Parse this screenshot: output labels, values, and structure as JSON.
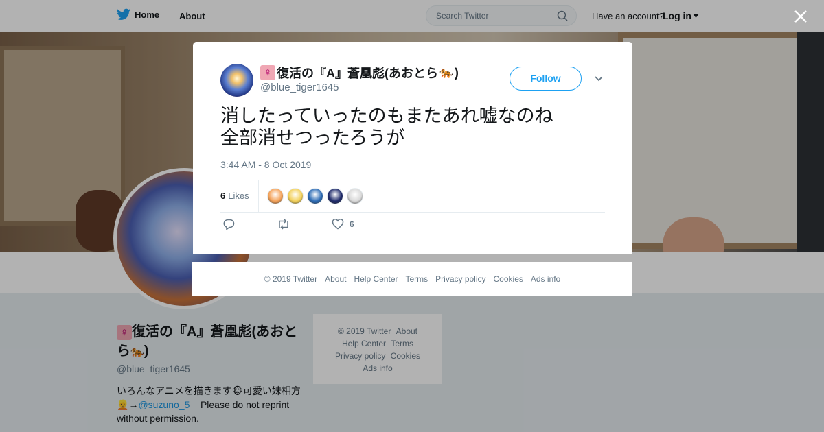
{
  "header": {
    "home_label": "Home",
    "about_label": "About",
    "search_placeholder": "Search Twitter",
    "have_account": "Have an account?",
    "login_label": "Log in"
  },
  "profile": {
    "name": "復活の『A』蒼凰彪(あおとら",
    "name_suffix": ")",
    "handle": "@blue_tiger1645",
    "bio_part1": "いろんなアニメを描きます",
    "bio_part2": "可愛い妹相方",
    "bio_arrow": "→",
    "bio_mention": "@suzuno_5",
    "bio_part3": "Please do not reprint without permission."
  },
  "side_footer": {
    "copyright": "© 2019 Twitter",
    "about": "About",
    "help": "Help Center",
    "terms": "Terms",
    "privacy": "Privacy policy",
    "cookies": "Cookies",
    "ads": "Ads info"
  },
  "tweet": {
    "author_name": "復活の『A』蒼凰彪(あおとら",
    "author_name_suffix": ")",
    "author_handle": "@blue_tiger1645",
    "follow_label": "Follow",
    "text_line1": "消したっていったのもまたあれ嘘なのね",
    "text_line2": "全部消せつったろうが",
    "timestamp": "3:44 AM - 8 Oct 2019",
    "likes_count": "6",
    "likes_label": "Likes",
    "like_action_count": "6",
    "liker_colors": [
      "#f4a259",
      "#f2d05a",
      "#2d6cb5",
      "#1e2a6a",
      "#d9d9d9"
    ]
  },
  "modal_footer": {
    "copyright": "© 2019 Twitter",
    "about": "About",
    "help": "Help Center",
    "terms": "Terms",
    "privacy": "Privacy policy",
    "cookies": "Cookies",
    "ads": "Ads info"
  },
  "colors": {
    "twitter_blue": "#1da1f2",
    "text_primary": "#14171a",
    "text_secondary": "#657786"
  },
  "icons": [
    "twitter-bird-icon",
    "search-icon",
    "caret-down-icon",
    "close-icon",
    "reply-icon",
    "retweet-icon",
    "heart-icon",
    "chevron-down-icon",
    "venus-emoji",
    "tiger-emoji"
  ]
}
